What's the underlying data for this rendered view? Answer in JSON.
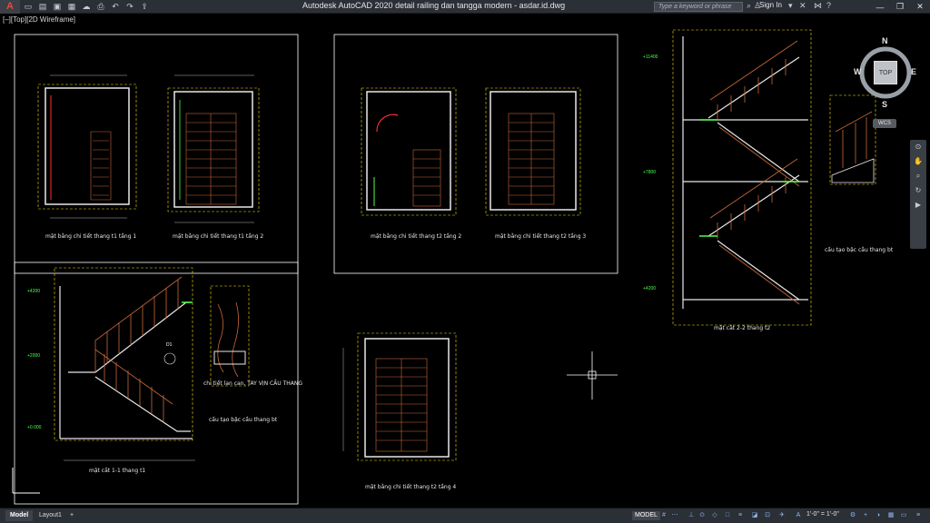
{
  "titlebar": {
    "app_icon": "A",
    "quick_access_icons": [
      "new-icon",
      "open-icon",
      "save-icon",
      "saveas-icon",
      "cloud-icon",
      "plot-icon",
      "undo-icon",
      "redo-icon",
      "share-icon"
    ],
    "title": "Autodesk AutoCAD 2020    detail railing dan tangga modern - asdar.id.dwg",
    "search_placeholder": "Type a keyword or phrase",
    "sign_in": "Sign In",
    "window_controls": [
      "minimize-icon",
      "restore-icon",
      "close-icon"
    ]
  },
  "viewport": {
    "label": "[–][Top][2D Wireframe]"
  },
  "drawing": {
    "plan_titles": [
      "mặt bằng chi tiết thang t1 tầng 1",
      "mặt bằng chi tiết thang t1 tầng 2",
      "mặt bằng chi tiết thang t2 tầng 2",
      "mặt bằng chi tiết thang t2 tầng 3",
      "mặt bằng chi tiết thang t2 tầng 4"
    ],
    "section_titles": [
      "mặt cắt 1-1 thang t1",
      "mặt cắt 2-2 thang t2"
    ],
    "detail_titles": [
      "chi tiết lan can, TAY VỊN CẦU THANG",
      "cấu tạo bậc cầu thang bt",
      "cấu tạo bậc cầu thang bt"
    ],
    "levels": [
      "+11400",
      "+7800",
      "+4200",
      "+4200",
      "+2000",
      "+0.000"
    ],
    "callout": "D1"
  },
  "viewcube": {
    "face": "TOP",
    "north": "N",
    "south": "S",
    "east": "E",
    "west": "W",
    "wcs": "WCS"
  },
  "statusbar": {
    "tabs": [
      "Model",
      "Layout1",
      "+"
    ],
    "model_button": "MODEL",
    "scale": "1'-0\" = 1'-0\""
  },
  "colors": {
    "frame": "#ffffff",
    "wall": "#e8e8e8",
    "railing": "#c9683a",
    "level": "#4cff4c",
    "dash": "#f0e000",
    "accent_red": "#ff3030",
    "background": "#000000"
  }
}
